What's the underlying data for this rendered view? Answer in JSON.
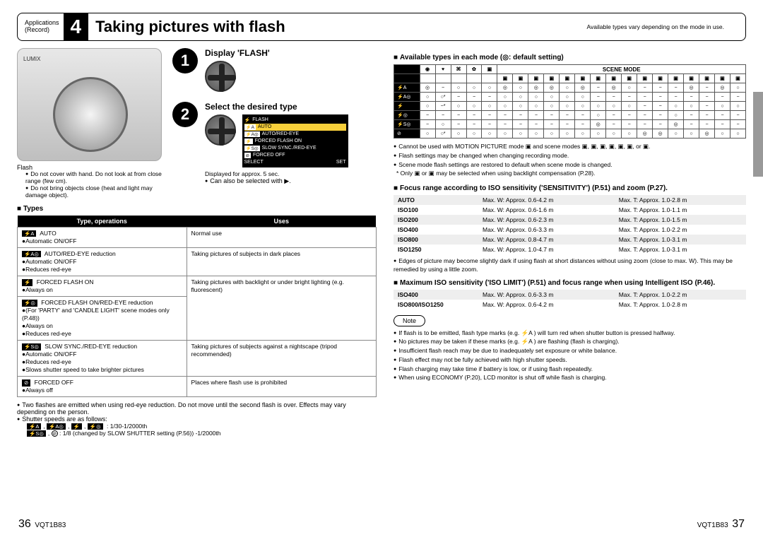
{
  "header": {
    "section1": "Applications",
    "section2": "(Record)",
    "num": "4",
    "title": "Taking pictures with flash",
    "note": "Available types vary depending on the mode in use."
  },
  "camera": {
    "label": "Flash",
    "note1": "Do not cover with hand. Do not look at from close range (few cm).",
    "note2": "Do not bring objects close (heat and light may damage object)."
  },
  "steps": {
    "s1_title": "Display 'FLASH'",
    "s2_title": "Select the desired type",
    "screen_rows": [
      "FLASH",
      "AUTO",
      "AUTO/RED-EYE",
      "FORCED FLASH ON",
      "SLOW SYNC./RED-EYE",
      "FORCED OFF"
    ],
    "screen_foot_l": "SELECT",
    "screen_foot_r": "SET",
    "s2_note1": "Displayed for approx. 5 sec.",
    "s2_note2": "Can also be selected with ▶."
  },
  "types_head": "Types",
  "types_th1": "Type, operations",
  "types_th2": "Uses",
  "types": [
    {
      "tag": "⚡A",
      "name": "AUTO",
      "ops": [
        "Automatic ON/OFF"
      ],
      "use": "Normal use"
    },
    {
      "tag": "⚡A◎",
      "name": "AUTO/RED-EYE reduction",
      "ops": [
        "Automatic ON/OFF",
        "Reduces red-eye"
      ],
      "use": "Taking pictures of subjects in dark places"
    },
    {
      "tag": "⚡",
      "name": "FORCED FLASH ON",
      "ops": [
        "Always on"
      ],
      "use": ""
    },
    {
      "tag": "⚡◎",
      "name": "FORCED FLASH ON/RED-EYE reduction",
      "ops": [
        "(For 'PARTY' and 'CANDLE LIGHT' scene modes only (P.48))",
        "Always on",
        "Reduces red-eye"
      ],
      "use": "Taking pictures with backlight or under bright lighting (e.g. fluorescent)"
    },
    {
      "tag": "⚡S◎",
      "name": "SLOW SYNC./RED-EYE reduction",
      "ops": [
        "Automatic ON/OFF",
        "Reduces red-eye",
        "Slows shutter speed to take brighter pictures"
      ],
      "use": "Taking pictures of subjects against a nightscape (tripod recommended)"
    },
    {
      "tag": "⊘",
      "name": "FORCED OFF",
      "ops": [
        "Always off"
      ],
      "use": "Places where flash use is prohibited"
    }
  ],
  "types_notes": [
    "Two flashes are emitted when using red-eye reduction. Do not move until the second flash is over. Effects may vary depending on the person.",
    "Shutter speeds are as follows:"
  ],
  "shutter1": "⚡A , ⚡A◎ , ⚡ , ⚡◎ : 1/30-1/2000th",
  "shutter2": "⚡S◎ , ⊘ : 1/8 (changed by SLOW SHUTTER setting (P.56)) -1/2000th",
  "right": {
    "avail_head": "Available types in each mode (◎: default setting)",
    "scene_mode": "SCENE MODE",
    "grid_rowlabels": [
      "⚡A",
      "⚡A◎",
      "⚡",
      "⚡◎",
      "⚡S◎",
      "⊘"
    ],
    "grid": [
      [
        "◎",
        "−",
        "○",
        "○",
        "○",
        "◎",
        "○",
        "◎",
        "◎",
        "○",
        "◎",
        "−",
        "◎",
        "○",
        "−",
        "−",
        "−",
        "◎",
        "−",
        "◎",
        "○"
      ],
      [
        "○",
        "○*",
        "−",
        "−",
        "−",
        "○",
        "○",
        "○",
        "○",
        "○",
        "○",
        "−",
        "−",
        "−",
        "−",
        "−",
        "−",
        "−",
        "−",
        "−",
        "−"
      ],
      [
        "○",
        "−*",
        "○",
        "○",
        "○",
        "○",
        "○",
        "○",
        "○",
        "○",
        "○",
        "○",
        "○",
        "○",
        "−",
        "−",
        "○",
        "○",
        "−",
        "○",
        "○"
      ],
      [
        "−",
        "−",
        "−",
        "−",
        "−",
        "−",
        "−",
        "−",
        "−",
        "−",
        "−",
        "○",
        "−",
        "−",
        "−",
        "−",
        "○",
        "−",
        "−",
        "−",
        "−"
      ],
      [
        "−",
        "○",
        "−",
        "−",
        "−",
        "−",
        "−",
        "−",
        "−",
        "−",
        "−",
        "◎",
        "−",
        "−",
        "−",
        "−",
        "◎",
        "−",
        "−",
        "−",
        "−"
      ],
      [
        "○",
        "○*",
        "○",
        "○",
        "○",
        "○",
        "○",
        "○",
        "○",
        "○",
        "○",
        "○",
        "○",
        "○",
        "◎",
        "◎",
        "○",
        "○",
        "◎",
        "○",
        "○"
      ]
    ],
    "grid_notes": [
      "Cannot be used with MOTION PICTURE mode ▣ and scene modes ▣, ▣, ▣, ▣, ▣, ▣, or ▣.",
      "Flash settings may be changed when changing recording mode.",
      "Scene mode flash settings are restored to default when scene mode is changed.",
      "* Only ▣ or ▣ may be selected when using backlight compensation (P.28)."
    ],
    "focus_head": "Focus range according to ISO sensitivity ('SENSITIVITY') (P.51) and zoom (P.27).",
    "iso": [
      {
        "l": "AUTO",
        "w": "Max. W: Approx. 0.6-4.2 m",
        "t": "Max. T: Approx. 1.0-2.8 m"
      },
      {
        "l": "ISO100",
        "w": "Max. W: Approx. 0.6-1.6 m",
        "t": "Max. T: Approx. 1.0-1.1 m"
      },
      {
        "l": "ISO200",
        "w": "Max. W: Approx. 0.6-2.3 m",
        "t": "Max. T: Approx. 1.0-1.5 m"
      },
      {
        "l": "ISO400",
        "w": "Max. W: Approx. 0.6-3.3 m",
        "t": "Max. T: Approx. 1.0-2.2 m"
      },
      {
        "l": "ISO800",
        "w": "Max. W: Approx. 0.8-4.7 m",
        "t": "Max. T: Approx. 1.0-3.1 m"
      },
      {
        "l": "ISO1250",
        "w": "Max. W: Approx. 1.0-4.7 m",
        "t": "Max. T: Approx. 1.0-3.1 m"
      }
    ],
    "edge_note": "Edges of picture may become slightly dark if using flash at short distances without using zoom (close to max. W). This may be remedied by using a little zoom.",
    "max_head": "Maximum ISO sensitivity ('ISO LIMIT') (P.51) and focus range when using Intelligent ISO (P.46).",
    "iso2": [
      {
        "l": "ISO400",
        "w": "Max. W: Approx. 0.6-3.3 m",
        "t": "Max. T: Approx. 1.0-2.2 m"
      },
      {
        "l": "ISO800/ISO1250",
        "w": "Max. W: Approx. 0.6-4.2 m",
        "t": "Max. T: Approx. 1.0-2.8 m"
      }
    ],
    "note_label": "Note",
    "note_items": [
      "If flash is to be emitted, flash type marks (e.g. ⚡A ) will turn red when shutter button is pressed halfway.",
      "No pictures may be taken if these marks (e.g. ⚡A ) are flashing (flash is charging).",
      "Insufficient flash reach may be due to inadequately set exposure or white balance.",
      "Flash effect may not be fully achieved with high shutter speeds.",
      "Flash charging may take time if battery is low, or if using flash repeatedly.",
      "When using ECONOMY (P.20), LCD monitor is shut off while flash is charging."
    ]
  },
  "footer": {
    "left_page": "36",
    "right_page": "37",
    "code": "VQT1B83"
  }
}
